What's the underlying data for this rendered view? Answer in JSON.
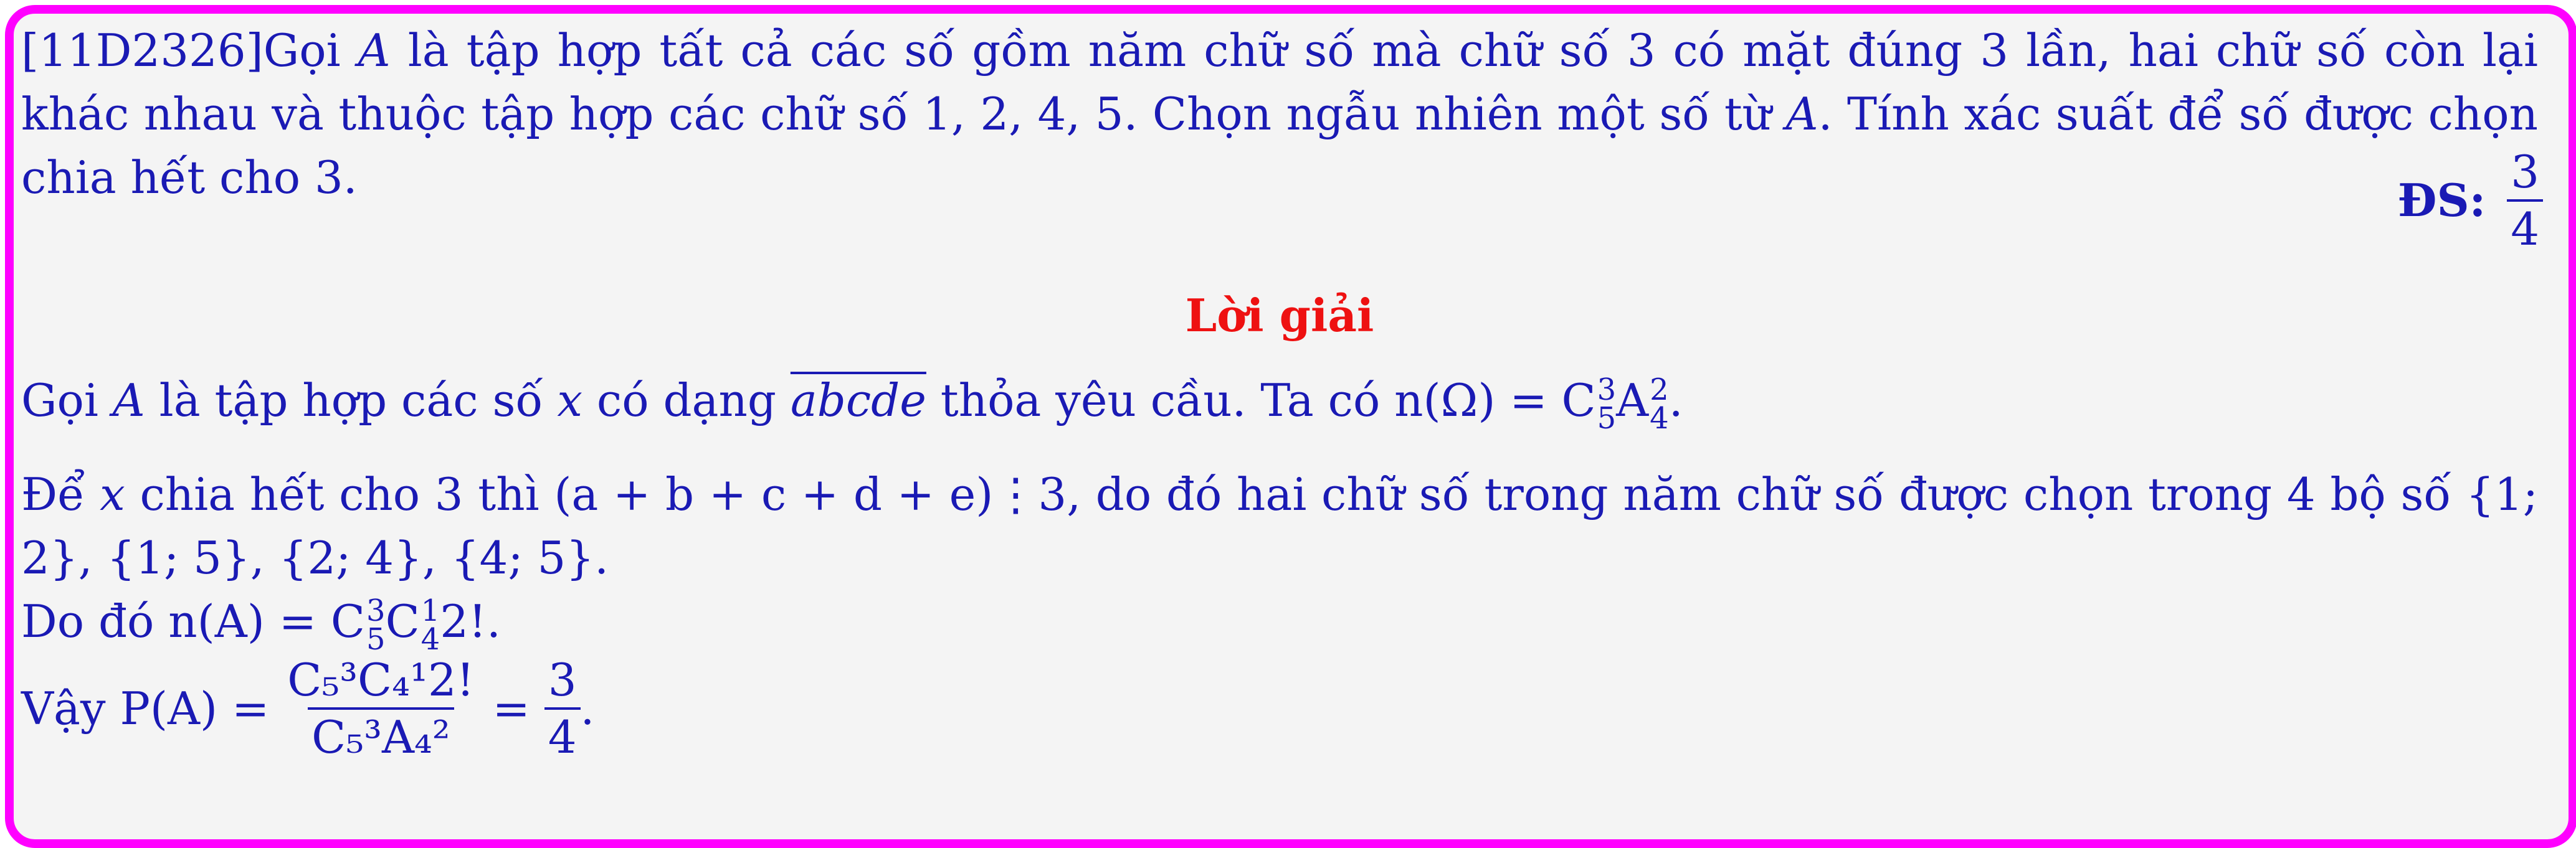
{
  "problem": {
    "id": "[11D2326]",
    "text_a": "Gọi",
    "set": "A",
    "text_b": "là tập hợp tất cả các số gồm năm chữ số mà chữ số 3 có mặt đúng 3 lần, hai chữ số còn lại khác nhau và thuộc tập hợp các chữ số 1, 2, 4, 5. Chọn ngẫu nhiên một số từ",
    "text_c": ". Tính xác suất để số được chọn chia hết cho 3.",
    "answer_label": "ĐS:",
    "answer_num": "3",
    "answer_den": "4"
  },
  "solution": {
    "heading": "Lời giải",
    "line1_a": "Gọi",
    "line1_b": "là tập hợp các số",
    "line1_x": "x",
    "line1_c": "có dạng",
    "line1_abcde": "abcde",
    "line1_d": "thỏa yêu cầu. Ta có n(Ω) = C",
    "line1_e": "A",
    "line2_a": "Để",
    "line2_b": "chia hết cho 3 thì (a + b + c + d + e)⋮3, do đó hai chữ số trong năm chữ số được chọn trong 4 bộ số {1; 2}, {1; 5}, {2; 4}, {4; 5}.",
    "line3": "Do đó n(A) = C",
    "line3_b": "C",
    "line3_c": "2!.",
    "line4_a": "Vậy P(A) =",
    "frac_num": "C₅³C₄¹2!",
    "frac_den": "C₅³A₄²",
    "eq": "=",
    "res_num": "3",
    "res_den": "4",
    "end": "."
  }
}
